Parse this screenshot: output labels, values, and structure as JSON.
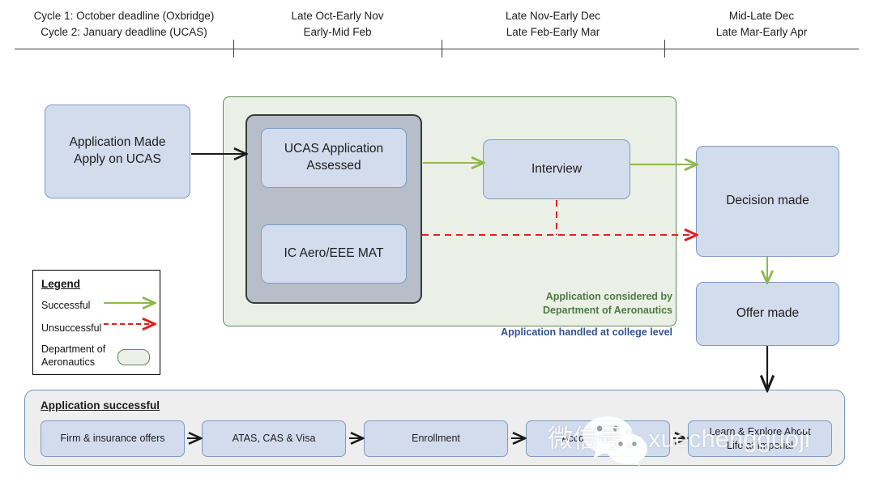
{
  "timeline": {
    "columns": [
      {
        "lines": [
          "Cycle 1: October deadline (Oxbridge)",
          "Cycle 2: January deadline (UCAS)"
        ]
      },
      {
        "lines": [
          "Late Oct-Early Nov",
          "Early-Mid Feb"
        ]
      },
      {
        "lines": [
          "Late Nov-Early Dec",
          "Late Feb-Early Mar"
        ]
      },
      {
        "lines": [
          "Mid-Late Dec",
          "Late Mar-Early Apr"
        ]
      }
    ]
  },
  "flow": {
    "application_made": {
      "line1": "Application Made",
      "line2": "Apply on UCAS"
    },
    "ucas_assessed": {
      "line1": "UCAS Application",
      "line2": "Assessed"
    },
    "mat": "IC Aero/EEE MAT",
    "interview": "Interview",
    "decision_made": "Decision made",
    "offer_made": "Offer made"
  },
  "captions": {
    "dept_line1": "Application considered by",
    "dept_line2": "Department of Aeronautics",
    "college": "Application handled at college level"
  },
  "legend": {
    "title": "Legend",
    "successful": "Successful",
    "unsuccessful": "Unsuccessful",
    "dept_line1": "Department of",
    "dept_line2": "Aeronautics"
  },
  "bottom": {
    "title": "Application successful",
    "steps": [
      "Firm & insurance offers",
      "ATAS, CAS & Visa",
      "Enrollment",
      "Accommodation"
    ],
    "last_step": {
      "line1": "Learn & Explore About",
      "line2": "Life at Imperial"
    }
  },
  "watermark": {
    "text": "微信号：xuechengguoji"
  },
  "colors": {
    "node_fill": "#d3dced",
    "node_border": "#7b9cc4",
    "green_fill": "#ebf0e7",
    "green_border": "#5d8a52",
    "grey_fill": "#b7bec9",
    "grey_border": "#3b3b3b",
    "success_arrow": "#8db94a",
    "fail_arrow": "#e02020",
    "plain_arrow": "#1a1a1a",
    "caption_green": "#4c7a42",
    "caption_blue": "#2f5496",
    "bottom_fill": "#eeeeee"
  }
}
